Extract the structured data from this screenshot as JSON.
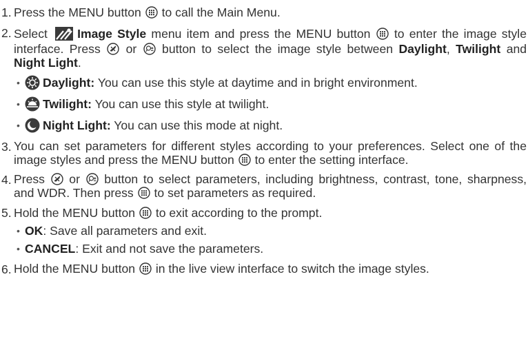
{
  "steps": [
    {
      "num": "1.",
      "t1": "Press the MENU button",
      "t2": "to call the Main Menu."
    },
    {
      "num": "2.",
      "t1": "Select",
      "item": "Image Style",
      "t2": "menu item and press the MENU button",
      "t3": "to enter the image style interface. Press",
      "or": "or",
      "t4": "button to select the image style between",
      "s1": "Daylight",
      "s2": "Twilight",
      "and": "and",
      "s3": "Night Light",
      "end": "."
    },
    {
      "num": "3.",
      "t1": "You can set parameters for different styles according to your preferences. Select one of the image styles and press the MENU button",
      "t2": "to enter the setting interface."
    },
    {
      "num": "4.",
      "t1": "Press",
      "or": "or",
      "t2": "button to select parameters, including brightness, contrast, tone, sharpness, and WDR. Then press",
      "t3": "to set parameters as required."
    },
    {
      "num": "5.",
      "t1": "Hold the MENU button",
      "t2": "to exit according to the prompt."
    },
    {
      "num": "6.",
      "t1": "Hold the MENU button",
      "t2": "in the live view interface to switch the image styles."
    }
  ],
  "styles": [
    {
      "name": "Daylight:",
      "desc": "You can use this style at daytime and in bright environment.",
      "icon": "sun-icon"
    },
    {
      "name": "Twilight:",
      "desc": "You can use this style at twilight.",
      "icon": "twilight-icon"
    },
    {
      "name": "Night Light:",
      "desc": "You can use this mode at night.",
      "icon": "moon-icon"
    }
  ],
  "prompt_options": [
    {
      "name": "OK",
      "desc": ": Save all parameters and exit."
    },
    {
      "name": "CANCEL",
      "desc": ": Exit and not save the parameters."
    }
  ],
  "icons": {
    "menu": "menu-button-icon",
    "image_style": "image-style-icon",
    "left": "brightness-button-icon",
    "right": "zoom-button-icon"
  },
  "colors": {
    "text": "#333333",
    "icon": "#3a3a3a"
  }
}
